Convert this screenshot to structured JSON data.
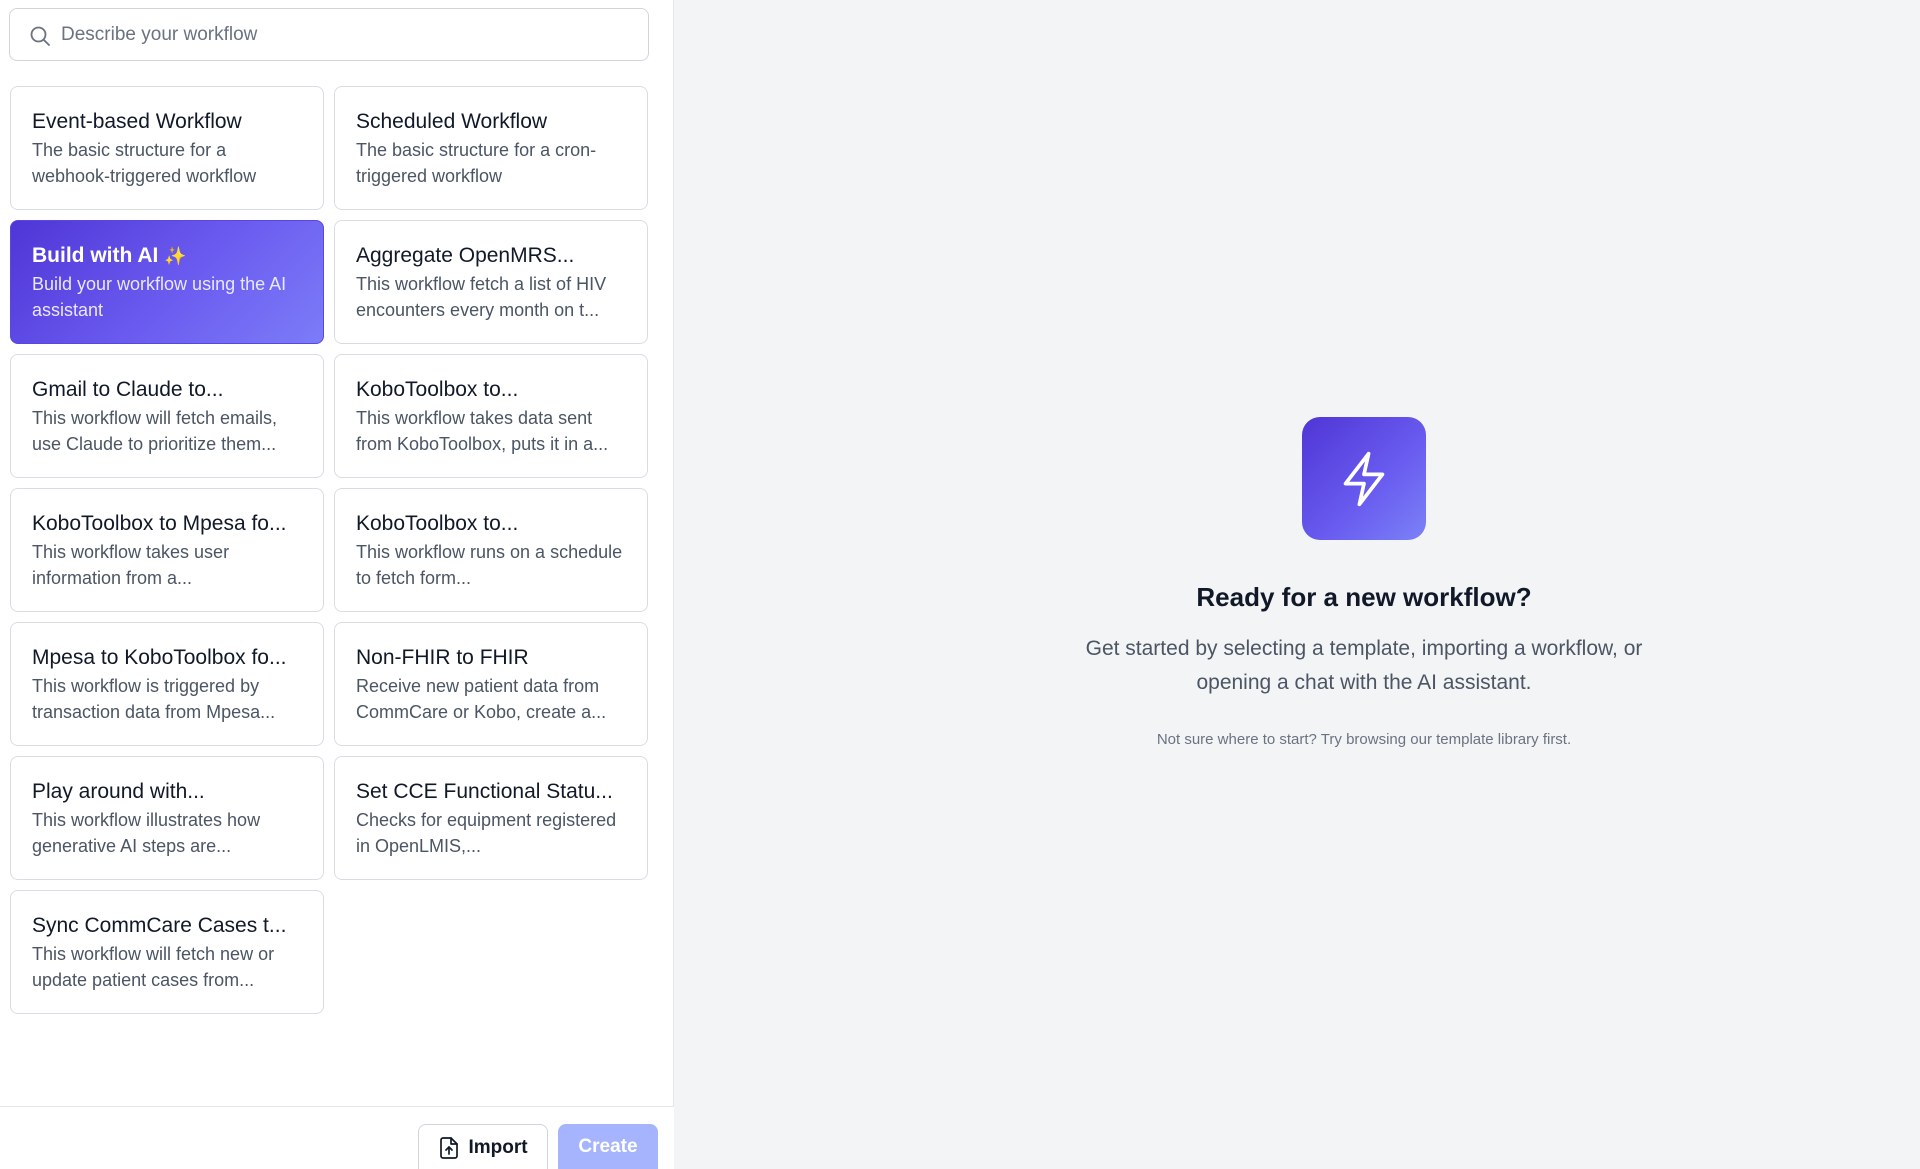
{
  "search": {
    "placeholder": "Describe your workflow",
    "icon": "search-icon"
  },
  "templates": [
    {
      "title": "Event-based Workflow",
      "description": "The basic structure for a webhook-triggered workflow"
    },
    {
      "title": "Scheduled Workflow",
      "description": "The basic structure for a cron-triggered workflow"
    },
    {
      "title": "Build with AI",
      "title_suffix": "✨",
      "description": "Build your workflow using the AI assistant",
      "selected": true
    },
    {
      "title": "Aggregate OpenMRS...",
      "description": "This workflow fetch a list of HIV encounters every month on t..."
    },
    {
      "title": "Gmail to Claude to...",
      "description": "This workflow will fetch emails, use Claude to prioritize them..."
    },
    {
      "title": "KoboToolbox to...",
      "description": "This workflow takes data sent from KoboToolbox, puts it in a..."
    },
    {
      "title": "KoboToolbox to Mpesa fo...",
      "description": "This workflow takes user information from a..."
    },
    {
      "title": "KoboToolbox to...",
      "description": "This workflow runs on a schedule to fetch form..."
    },
    {
      "title": "Mpesa to KoboToolbox fo...",
      "description": "This workflow is triggered by transaction data from Mpesa..."
    },
    {
      "title": "Non-FHIR to FHIR",
      "description": "Receive new patient data from CommCare or Kobo, create a..."
    },
    {
      "title": "Play around with...",
      "description": "This workflow illustrates how generative AI steps are..."
    },
    {
      "title": "Set CCE Functional Statu...",
      "description": "Checks for equipment registered in OpenLMIS,..."
    },
    {
      "title": "Sync CommCare Cases t...",
      "description": "This workflow will fetch new or update patient cases from..."
    }
  ],
  "footer": {
    "import_label": "Import",
    "create_label": "Create"
  },
  "empty_state": {
    "title": "Ready for a new workflow?",
    "subtitle": "Get started by selecting a template, importing a workflow, or opening a chat with the AI assistant.",
    "hint": "Not sure where to start? Try browsing our template library first.",
    "icon": "lightning-bolt-icon"
  },
  "colors": {
    "accent_start": "#4f35d6",
    "accent_end": "#7c7cf8",
    "create_disabled": "#a5b4fc",
    "panel_bg": "#f3f4f6"
  }
}
